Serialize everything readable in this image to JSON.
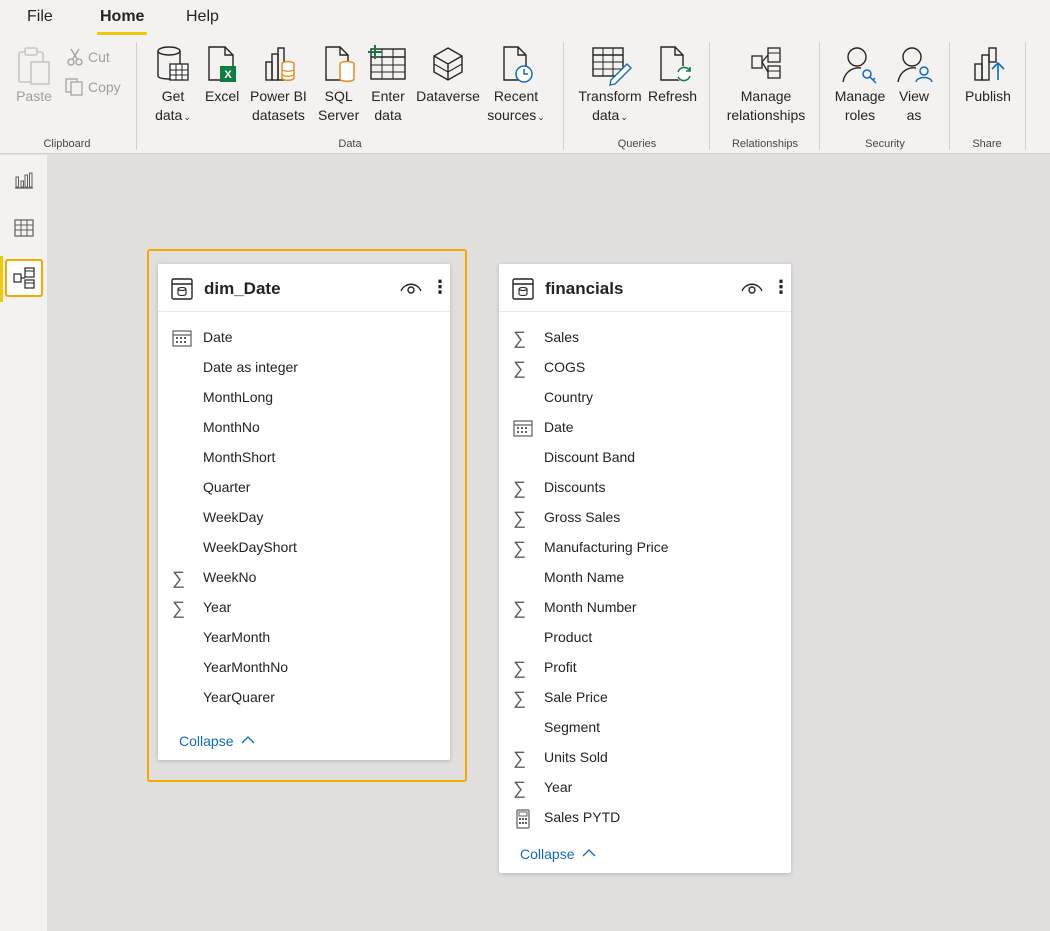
{
  "menu": {
    "tabs": [
      "File",
      "Home",
      "Help"
    ],
    "active": "Home"
  },
  "ribbon": {
    "clipboard": {
      "paste": "Paste",
      "cut": "Cut",
      "copy": "Copy",
      "group": "Clipboard"
    },
    "data": {
      "get_data": [
        "Get",
        "data"
      ],
      "excel": [
        "Excel"
      ],
      "powerbi": [
        "Power BI",
        "datasets"
      ],
      "sql": [
        "SQL",
        "Server"
      ],
      "enter": [
        "Enter",
        "data"
      ],
      "dataverse": [
        "Dataverse"
      ],
      "recent": [
        "Recent",
        "sources"
      ],
      "group": "Data"
    },
    "queries": {
      "transform": [
        "Transform",
        "data"
      ],
      "refresh": [
        "Refresh"
      ],
      "group": "Queries"
    },
    "relationships": {
      "manage": [
        "Manage",
        "relationships"
      ],
      "group": "Relationships"
    },
    "security": {
      "roles": [
        "Manage",
        "roles"
      ],
      "view": [
        "View",
        "as"
      ],
      "group": "Security"
    },
    "share": {
      "publish": [
        "Publish"
      ],
      "group": "Share"
    }
  },
  "rail": [
    "report-view",
    "data-view",
    "model-view"
  ],
  "tables": [
    {
      "title": "dim_Date",
      "collapse": "Collapse",
      "fields": [
        {
          "name": "Date",
          "icon": "calendar"
        },
        {
          "name": "Date as integer",
          "icon": ""
        },
        {
          "name": "MonthLong",
          "icon": ""
        },
        {
          "name": "MonthNo",
          "icon": ""
        },
        {
          "name": "MonthShort",
          "icon": ""
        },
        {
          "name": "Quarter",
          "icon": ""
        },
        {
          "name": "WeekDay",
          "icon": ""
        },
        {
          "name": "WeekDayShort",
          "icon": ""
        },
        {
          "name": "WeekNo",
          "icon": "sigma"
        },
        {
          "name": "Year",
          "icon": "sigma"
        },
        {
          "name": "YearMonth",
          "icon": ""
        },
        {
          "name": "YearMonthNo",
          "icon": ""
        },
        {
          "name": "YearQuarer",
          "icon": ""
        }
      ]
    },
    {
      "title": "financials",
      "collapse": "Collapse",
      "fields": [
        {
          "name": "Sales",
          "icon": "sigma"
        },
        {
          "name": "COGS",
          "icon": "sigma"
        },
        {
          "name": "Country",
          "icon": ""
        },
        {
          "name": "Date",
          "icon": "calendar"
        },
        {
          "name": "Discount Band",
          "icon": ""
        },
        {
          "name": "Discounts",
          "icon": "sigma"
        },
        {
          "name": "Gross Sales",
          "icon": "sigma"
        },
        {
          "name": "Manufacturing Price",
          "icon": "sigma"
        },
        {
          "name": "Month Name",
          "icon": ""
        },
        {
          "name": "Month Number",
          "icon": "sigma"
        },
        {
          "name": "Product",
          "icon": ""
        },
        {
          "name": "Profit",
          "icon": "sigma"
        },
        {
          "name": "Sale Price",
          "icon": "sigma"
        },
        {
          "name": "Segment",
          "icon": ""
        },
        {
          "name": "Units Sold",
          "icon": "sigma"
        },
        {
          "name": "Year",
          "icon": "sigma"
        },
        {
          "name": "Sales PYTD",
          "icon": "calculator"
        }
      ]
    }
  ]
}
